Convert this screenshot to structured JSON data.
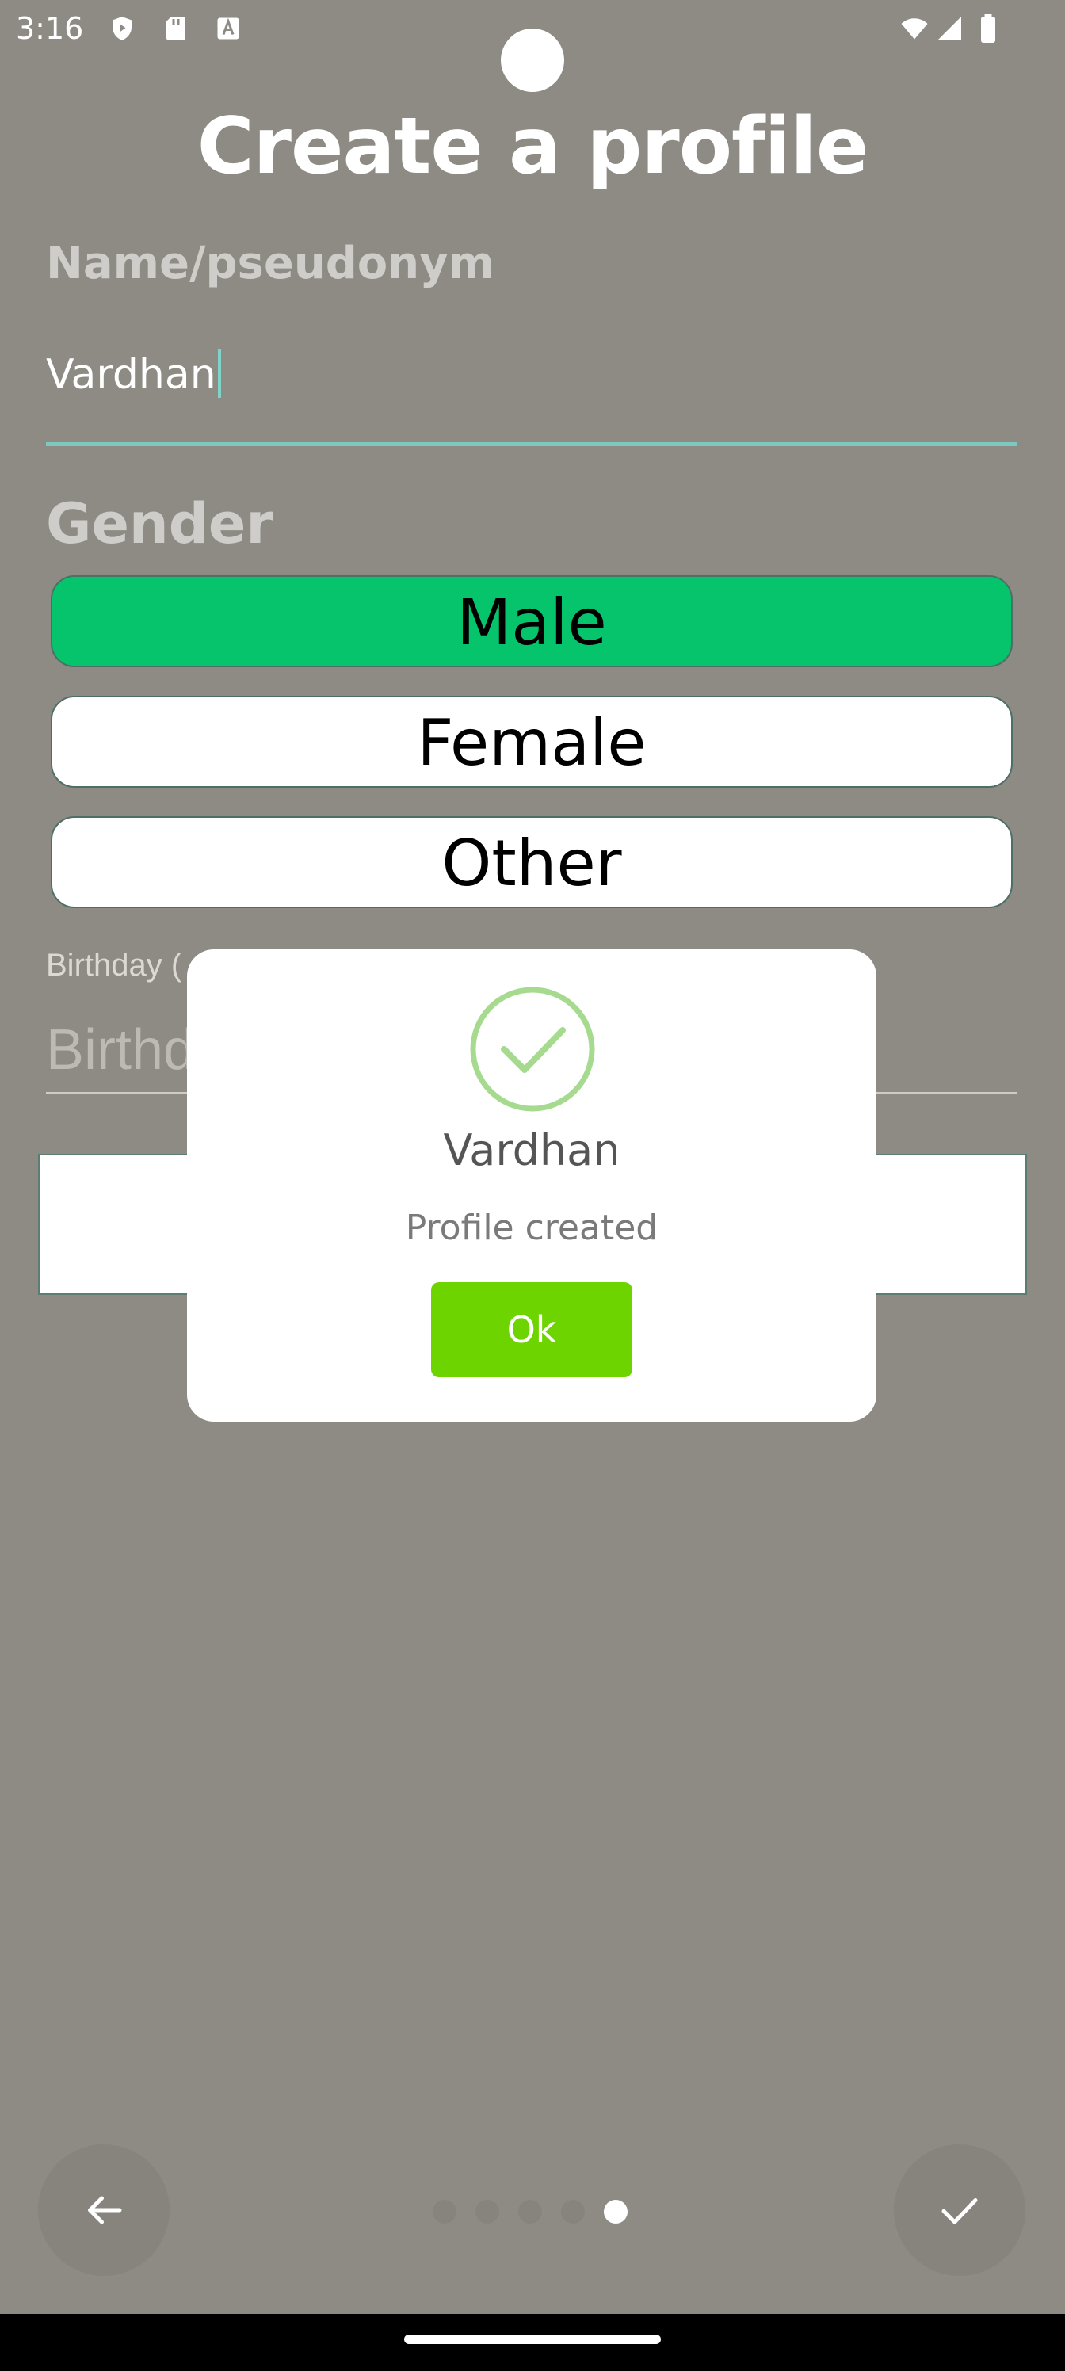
{
  "status_bar": {
    "time": "3:16",
    "icons": [
      "shield-icon",
      "sd-card-icon",
      "font-a-icon",
      "wifi-icon",
      "cell-signal-icon",
      "battery-icon"
    ]
  },
  "page": {
    "title": "Create a profile",
    "name_label": "Name/pseudonym",
    "name_value": "Vardhan",
    "gender_label": "Gender",
    "gender_options": [
      {
        "label": "Male",
        "selected": true
      },
      {
        "label": "Female",
        "selected": false
      },
      {
        "label": "Other",
        "selected": false
      }
    ],
    "birthday_label_partial": "Birthday (",
    "birthday_placeholder_partial": "Birthd"
  },
  "dialog": {
    "icon": "check-circle-icon",
    "name": "Vardhan",
    "message": "Profile created",
    "ok_label": "Ok"
  },
  "navigation": {
    "back_icon": "arrow-left-icon",
    "done_icon": "check-icon",
    "page_count": 5,
    "current_page": 5
  },
  "colors": {
    "background": "#8e8a84",
    "selected_option": "#06c46b",
    "ok_button": "#6dd400",
    "check_icon": "#a6db8f",
    "input_accent": "#7dc9bf"
  }
}
